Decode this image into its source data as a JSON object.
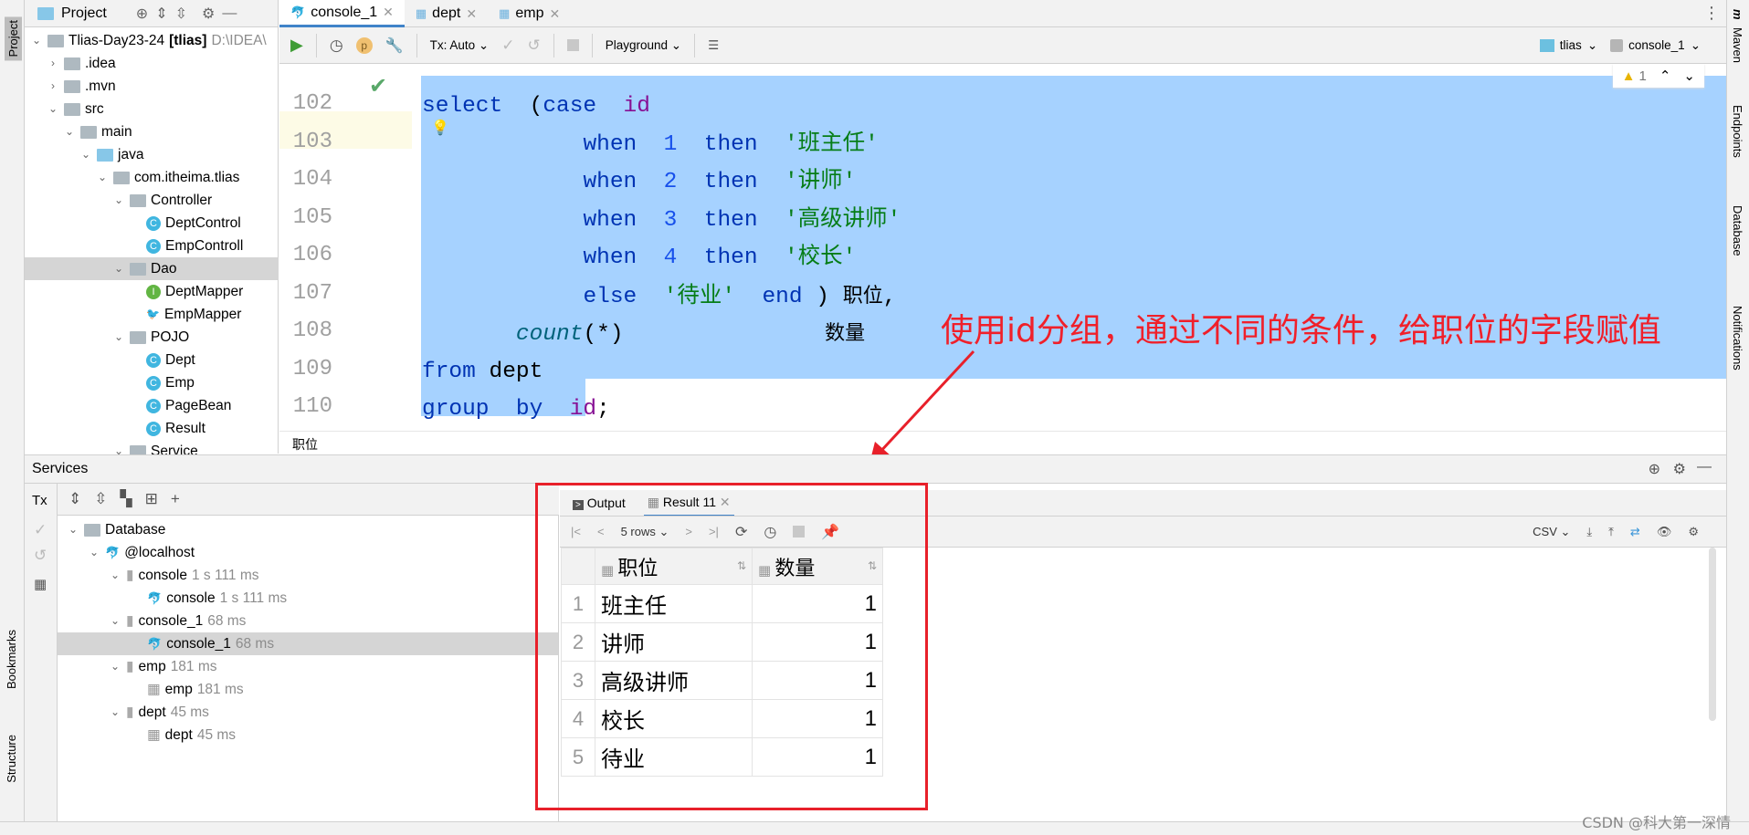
{
  "sidebar_left": {
    "top": "Project",
    "bookmarks": "Bookmarks",
    "structure": "Structure"
  },
  "sidebar_right": {
    "maven": "Maven",
    "endpoints": "Endpoints",
    "database": "Database",
    "notifications": "Notifications"
  },
  "project": {
    "title": "Project",
    "tree": [
      {
        "label": "Tlias-Day23-24",
        "bold": "[tlias]",
        "path": "D:\\IDEA\\",
        "icon": "module",
        "depth": 0,
        "chev": "v"
      },
      {
        "label": ".idea",
        "icon": "folder",
        "depth": 1,
        "chev": ">"
      },
      {
        "label": ".mvn",
        "icon": "folder",
        "depth": 1,
        "chev": ">"
      },
      {
        "label": "src",
        "icon": "folder",
        "depth": 1,
        "chev": "v"
      },
      {
        "label": "main",
        "icon": "folder",
        "depth": 2,
        "chev": "v"
      },
      {
        "label": "java",
        "icon": "folder-blue",
        "depth": 3,
        "chev": "v"
      },
      {
        "label": "com.itheima.tlias",
        "icon": "package",
        "depth": 4,
        "chev": "v"
      },
      {
        "label": "Controller",
        "icon": "package",
        "depth": 5,
        "chev": "v"
      },
      {
        "label": "DeptControl",
        "icon": "class",
        "depth": 6
      },
      {
        "label": "EmpControll",
        "icon": "class",
        "depth": 6
      },
      {
        "label": "Dao",
        "icon": "package",
        "depth": 5,
        "chev": "v",
        "selected": true
      },
      {
        "label": "DeptMapper",
        "icon": "interface",
        "depth": 6
      },
      {
        "label": "EmpMapper",
        "icon": "mybatis",
        "depth": 6
      },
      {
        "label": "POJO",
        "icon": "package",
        "depth": 5,
        "chev": "v"
      },
      {
        "label": "Dept",
        "icon": "class",
        "depth": 6
      },
      {
        "label": "Emp",
        "icon": "class",
        "depth": 6
      },
      {
        "label": "PageBean",
        "icon": "class",
        "depth": 6
      },
      {
        "label": "Result",
        "icon": "class",
        "depth": 6
      },
      {
        "label": "Service",
        "icon": "package",
        "depth": 5,
        "chev": "v"
      }
    ]
  },
  "tabs": [
    {
      "label": "console_1",
      "active": true
    },
    {
      "label": "dept"
    },
    {
      "label": "emp"
    }
  ],
  "toolbar": {
    "tx": "Tx: Auto",
    "playground": "Playground",
    "datasource": "tlias",
    "session": "console_1"
  },
  "inspection": {
    "warnings": "1"
  },
  "editor": {
    "first_line": "101",
    "lines": [
      {
        "n": "102",
        "tokens": [
          [
            "kw",
            "select"
          ],
          [
            "",
            "  ("
          ],
          [
            "kw",
            "case"
          ],
          [
            "",
            "  "
          ],
          [
            "idf",
            "id"
          ]
        ]
      },
      {
        "n": "103",
        "tokens": [
          [
            "",
            "            "
          ],
          [
            "kw",
            "when"
          ],
          [
            "",
            "  "
          ],
          [
            "num",
            "1"
          ],
          [
            "",
            "  "
          ],
          [
            "kw",
            "then"
          ],
          [
            "",
            "  "
          ],
          [
            "str",
            "'班主任'"
          ]
        ]
      },
      {
        "n": "104",
        "tokens": [
          [
            "",
            "            "
          ],
          [
            "kw",
            "when"
          ],
          [
            "",
            "  "
          ],
          [
            "num",
            "2"
          ],
          [
            "",
            "  "
          ],
          [
            "kw",
            "then"
          ],
          [
            "",
            "  "
          ],
          [
            "str",
            "'讲师'"
          ]
        ]
      },
      {
        "n": "105",
        "tokens": [
          [
            "",
            "            "
          ],
          [
            "kw",
            "when"
          ],
          [
            "",
            "  "
          ],
          [
            "num",
            "3"
          ],
          [
            "",
            "  "
          ],
          [
            "kw",
            "then"
          ],
          [
            "",
            "  "
          ],
          [
            "str",
            "'高级讲师'"
          ]
        ]
      },
      {
        "n": "106",
        "tokens": [
          [
            "",
            "            "
          ],
          [
            "kw",
            "when"
          ],
          [
            "",
            "  "
          ],
          [
            "num",
            "4"
          ],
          [
            "",
            "  "
          ],
          [
            "kw",
            "then"
          ],
          [
            "",
            "  "
          ],
          [
            "str",
            "'校长'"
          ]
        ]
      },
      {
        "n": "107",
        "tokens": [
          [
            "",
            "            "
          ],
          [
            "kw",
            "else"
          ],
          [
            "",
            "  "
          ],
          [
            "str",
            "'待业'"
          ],
          [
            "",
            "  "
          ],
          [
            "kw",
            "end"
          ],
          [
            "",
            " ) "
          ],
          [
            "cn",
            "职位"
          ],
          [
            "",
            ","
          ]
        ]
      },
      {
        "n": "108",
        "tokens": [
          [
            "",
            "       "
          ],
          [
            "fn",
            "count"
          ],
          [
            "",
            "(*)               "
          ],
          [
            "cn",
            "数量"
          ]
        ]
      },
      {
        "n": "109",
        "tokens": [
          [
            "kw",
            "from"
          ],
          [
            "",
            " dept"
          ]
        ]
      },
      {
        "n": "110",
        "tokens": [
          [
            "kw",
            "group"
          ],
          [
            "",
            "  "
          ],
          [
            "kw",
            "by"
          ],
          [
            "",
            "  "
          ],
          [
            "idf",
            "id"
          ],
          [
            "",
            ";"
          ]
        ]
      }
    ],
    "breadcrumb": "职位"
  },
  "annotation": "使用id分组，通过不同的条件，给职位的字段赋值",
  "services": {
    "title": "Services",
    "tx": "Tx",
    "tree": [
      {
        "label": "Database",
        "depth": 0,
        "icon": "folder",
        "chev": "v"
      },
      {
        "label": "@localhost",
        "depth": 1,
        "icon": "mysql",
        "chev": "v"
      },
      {
        "label": "console",
        "time": "1 s 111 ms",
        "depth": 2,
        "icon": "session",
        "chev": "v"
      },
      {
        "label": "console",
        "time": "1 s 111 ms",
        "depth": 3,
        "icon": "mysql"
      },
      {
        "label": "console_1",
        "time": "68 ms",
        "depth": 2,
        "icon": "session",
        "chev": "v"
      },
      {
        "label": "console_1",
        "time": "68 ms",
        "depth": 3,
        "icon": "mysql",
        "selected": true
      },
      {
        "label": "emp",
        "time": "181 ms",
        "depth": 2,
        "icon": "session",
        "chev": "v"
      },
      {
        "label": "emp",
        "time": "181 ms",
        "depth": 3,
        "icon": "table"
      },
      {
        "label": "dept",
        "time": "45 ms",
        "depth": 2,
        "icon": "session",
        "chev": "v"
      },
      {
        "label": "dept",
        "time": "45 ms",
        "depth": 3,
        "icon": "table"
      }
    ]
  },
  "results": {
    "tabs": {
      "output": "Output",
      "result": "Result 11"
    },
    "rows_label": "5 rows",
    "export": "CSV",
    "columns": [
      "职位",
      "数量"
    ],
    "rows": [
      [
        "1",
        "班主任",
        "1"
      ],
      [
        "2",
        "讲师",
        "1"
      ],
      [
        "3",
        "高级讲师",
        "1"
      ],
      [
        "4",
        "校长",
        "1"
      ],
      [
        "5",
        "待业",
        "1"
      ]
    ]
  },
  "watermark": "CSDN @科大第一深情",
  "colors": {
    "selection": "#a6d2ff",
    "annotation": "#f0202a",
    "keyword": "#0033b3",
    "string": "#067d17"
  }
}
